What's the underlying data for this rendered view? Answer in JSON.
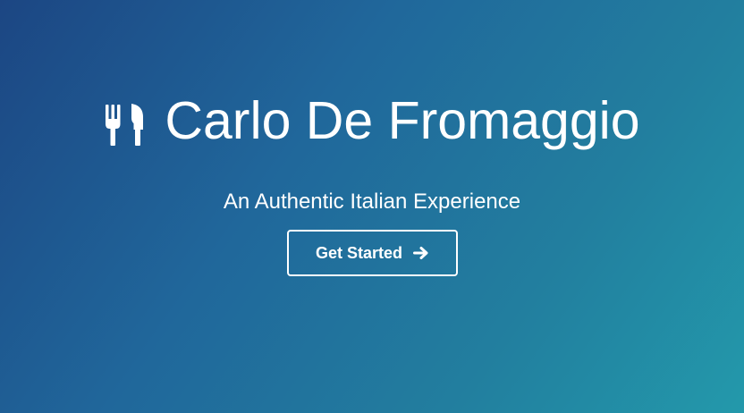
{
  "hero": {
    "title": "Carlo De Fromaggio",
    "subtitle": "An Authentic Italian Experience",
    "cta_label": "Get Started",
    "icons": {
      "brand": "fork-knife-icon",
      "cta": "arrow-right-icon"
    },
    "colors": {
      "gradient_start": "#1c4683",
      "gradient_end": "#2399ab",
      "text": "#ffffff"
    }
  }
}
